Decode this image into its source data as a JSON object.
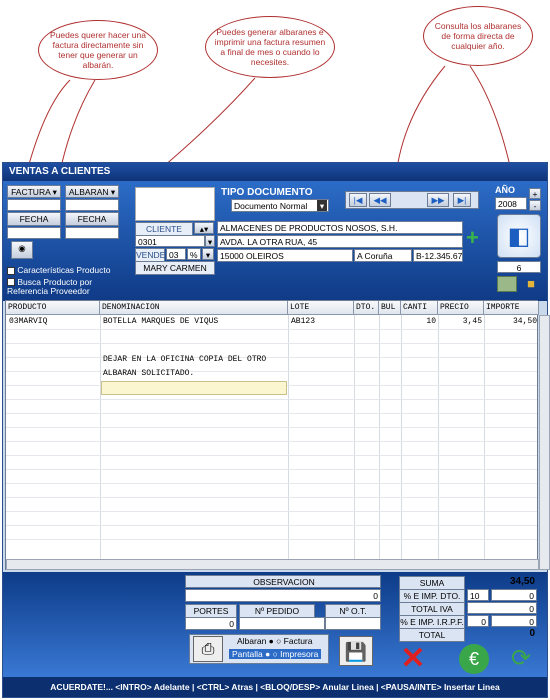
{
  "callouts": {
    "factura": "Puedes querer hacer una factura directamente sin tener que generar un albarán.",
    "albaranes": "Puedes generar albaranes e imprimir una factura resumen a final de mes o cuando lo necesites.",
    "consulta": "Consulta los albaranes de forma directa de cualquier año."
  },
  "window": {
    "title": "VENTAS A CLIENTES"
  },
  "top": {
    "factura_label": "FACTURA",
    "albaran_label": "ALBARAN",
    "fecha_label": "FECHA",
    "fecha2_label": "FECHA",
    "chk_caracteristicas": "Características Producto",
    "chk_busca": "Busca Producto por Referencia Proveedor",
    "cliente_label": "CLIENTE",
    "cliente_code": "0301",
    "vende_label": "VENDE",
    "vende_value": "03",
    "vende_pct": "%",
    "vendedor_name": "MARY CARMEN",
    "tipo_doc_label": "TIPO DOCUMENTO",
    "tipo_doc_value": "Documento Normal",
    "client_name": "ALMACENES DE PRODUCTOS NOSOS, S.H.",
    "client_address": "AVDA. LA OTRA RUA, 45",
    "client_city": "15000 OLEIROS",
    "client_province": "A Coruña",
    "client_nif": "B-12.345.678",
    "ano_label": "AÑO",
    "ano_value": "2008",
    "counter": "6"
  },
  "grid": {
    "headers": [
      "PRODUCTO",
      "DENOMINACION",
      "LOTE",
      "DTO.",
      "BUL",
      "CANTI",
      "PRECIO",
      "IMPORTE"
    ],
    "rows": [
      {
        "producto": "03MARVIQ",
        "denominacion": "BOTELLA MARQUES DE VIQUS",
        "lote": "AB123",
        "canti": "10",
        "precio": "3,45",
        "importe": "34,50"
      }
    ],
    "note_lines": [
      "DEJAR EN LA OFICINA COPIA DEL OTRO",
      "ALBARAN SOLICITADO."
    ]
  },
  "footer": {
    "observacion_label": "OBSERVACION",
    "observacion_value": "0",
    "portes_label": "PORTES",
    "portes_value": "0",
    "pedido_label": "Nº PEDIDO",
    "ot_label": "Nº O.T.",
    "albaran_opt": "Albaran",
    "factura_opt": "Factura",
    "pantalla_opt": "Pantalla",
    "impresora_opt": "Impresora",
    "suma_label": "SUMA",
    "suma_value": "34,50",
    "dto_label": "% E IMP. DTO.",
    "dto_pct": "10",
    "dto_value": "0",
    "total_iva_label": "TOTAL IVA",
    "total_iva_value": "0",
    "irpf_label": "% E IMP. I.R.P.F.",
    "irpf_pct": "0",
    "irpf_value": "0",
    "total_label": "TOTAL",
    "total_value": "0"
  },
  "status": "ACUERDATE!... <INTRO> Adelante | <CTRL> Atras | <BLOQ/DESP> Anular Linea | <PAUSA/INTE> Insertar Linea"
}
